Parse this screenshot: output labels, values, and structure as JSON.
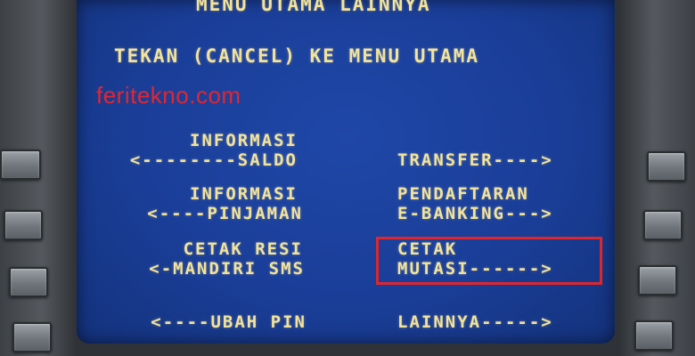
{
  "header": {
    "title": "MENU UTAMA LAINNYA",
    "instruction": "TEKAN (CANCEL) KE MENU UTAMA"
  },
  "watermark": "feritekno.com",
  "left_options": [
    {
      "line1": "INFORMASI",
      "line2": "<--------SALDO"
    },
    {
      "line1": "INFORMASI",
      "line2": "<----PINJAMAN"
    },
    {
      "line1": "CETAK RESI",
      "line2": "<-MANDIRI SMS"
    },
    {
      "line1": "",
      "line2": "<----UBAH PIN"
    }
  ],
  "right_options": [
    {
      "line1": "",
      "line2": "TRANSFER---->"
    },
    {
      "line1": "PENDAFTARAN",
      "line2": "E-BANKING--->"
    },
    {
      "line1": "CETAK",
      "line2": "MUTASI------>"
    },
    {
      "line1": "",
      "line2": "LAINNYA----->"
    }
  ],
  "colors": {
    "screen_bg": "#1a3e98",
    "text": "#f3e39a",
    "highlight": "#e0262d",
    "watermark": "#e3262f"
  }
}
